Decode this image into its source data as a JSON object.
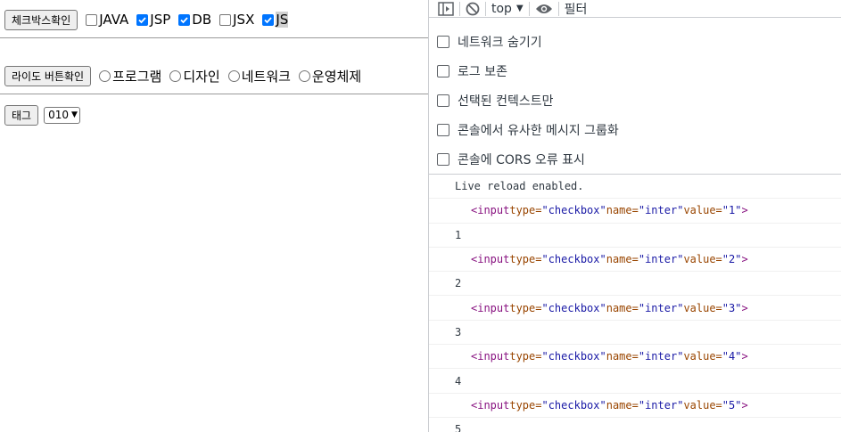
{
  "form": {
    "check_button": "체크박스확인",
    "checkboxes": [
      {
        "label": "JAVA",
        "checked": false
      },
      {
        "label": "JSP",
        "checked": true
      },
      {
        "label": "DB",
        "checked": true
      },
      {
        "label": "JSX",
        "checked": false
      },
      {
        "label": "JS",
        "checked": true
      }
    ],
    "radio_button": "라이도 버튼확인",
    "radios": [
      {
        "label": "프로그램"
      },
      {
        "label": "디자인"
      },
      {
        "label": "네트워크"
      },
      {
        "label": "운영체제"
      }
    ],
    "tag_button": "태그",
    "select_value": "010"
  },
  "devtools": {
    "toolbar": {
      "context": "top",
      "filter_placeholder": "필터"
    },
    "settings": [
      "네트워크 숨기기",
      "로그 보존",
      "선택된 컨텍스트만",
      "콘솔에서 유사한 메시지 그룹화",
      "콘솔에 CORS 오류 표시"
    ],
    "log": {
      "live_reload": "Live reload enabled.",
      "entries": [
        {
          "tag_open": "<input",
          "type_attr": "type=",
          "type_val": "\"checkbox\"",
          "name_attr": "name=",
          "name_val": "\"inter\"",
          "value_attr": "value=",
          "value_val": "\"1\"",
          "tag_close": ">",
          "output": "1"
        },
        {
          "tag_open": "<input",
          "type_attr": "type=",
          "type_val": "\"checkbox\"",
          "name_attr": "name=",
          "name_val": "\"inter\"",
          "value_attr": "value=",
          "value_val": "\"2\"",
          "tag_close": ">",
          "output": "2"
        },
        {
          "tag_open": "<input",
          "type_attr": "type=",
          "type_val": "\"checkbox\"",
          "name_attr": "name=",
          "name_val": "\"inter\"",
          "value_attr": "value=",
          "value_val": "\"3\"",
          "tag_close": ">",
          "output": "3"
        },
        {
          "tag_open": "<input",
          "type_attr": "type=",
          "type_val": "\"checkbox\"",
          "name_attr": "name=",
          "name_val": "\"inter\"",
          "value_attr": "value=",
          "value_val": "\"4\"",
          "tag_close": ">",
          "output": "4"
        },
        {
          "tag_open": "<input",
          "type_attr": "type=",
          "type_val": "\"checkbox\"",
          "name_attr": "name=",
          "name_val": "\"inter\"",
          "value_attr": "value=",
          "value_val": "\"5\"",
          "tag_close": ">",
          "output": "5"
        }
      ]
    }
  },
  "colors": {
    "checkbox_checked": "#0075ff",
    "tag": "#881280",
    "attr": "#994500",
    "value": "#1a1aa6"
  },
  "icons": [
    "sidebar-toggle-icon",
    "clear-console-icon",
    "dropdown-arrow-icon",
    "eye-icon",
    "checkmark-icon"
  ]
}
